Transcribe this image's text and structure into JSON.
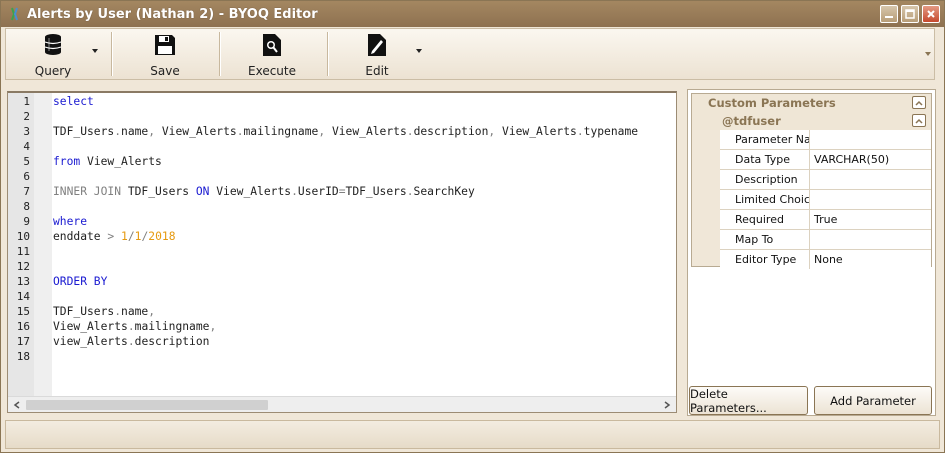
{
  "window": {
    "title": "Alerts by User (Nathan 2) - BYOQ Editor",
    "controls": [
      "minimize-icon",
      "maximize-icon",
      "close-icon"
    ]
  },
  "toolbar": {
    "query_label": "Query",
    "save_label": "Save",
    "execute_label": "Execute",
    "edit_label": "Edit"
  },
  "editor": {
    "line_numbers": [
      "1",
      "2",
      "3",
      "4",
      "5",
      "6",
      "7",
      "8",
      "9",
      "10",
      "11",
      "12",
      "13",
      "14",
      "15",
      "16",
      "17",
      "18"
    ],
    "tokens": {
      "l1_select": "select",
      "l3_a": "TDF_Users",
      "l3_dot1": ".",
      "l3_b": "name",
      "l3_c1": ",",
      "l3_c": " View_Alerts",
      "l3_dot2": ".",
      "l3_d": "mailingname",
      "l3_c2": ",",
      "l3_e": " View_Alerts",
      "l3_dot3": ".",
      "l3_f": "description",
      "l3_c3": ",",
      "l3_g": " View_Alerts",
      "l3_dot4": ".",
      "l3_h": "typename",
      "l5_from": "from",
      "l5_tbl": " View_Alerts",
      "l7_inner": "INNER JOIN",
      "l7_tbl": " TDF_Users ",
      "l7_on": "ON",
      "l7_a": " View_Alerts",
      "l7_dot1": ".",
      "l7_b": "UserID",
      "l7_eq": "=",
      "l7_c": "TDF_Users",
      "l7_dot2": ".",
      "l7_d": "SearchKey",
      "l9_where": "where",
      "l10_a": "enddate ",
      "l10_gt": ">",
      "l10_sp": " ",
      "l10_n1": "1",
      "l10_s1": "/",
      "l10_n2": "1",
      "l10_s2": "/",
      "l10_n3": "2018",
      "l13_order": "ORDER BY",
      "l15_a": "TDF_Users",
      "l15_dot": ".",
      "l15_b": "name",
      "l15_c": ",",
      "l16_a": "View_Alerts",
      "l16_dot": ".",
      "l16_b": "mailingname",
      "l16_c": ",",
      "l17_a": "view_Alerts",
      "l17_dot": ".",
      "l17_b": "description"
    },
    "scroll_left_icon": "chevron-left-icon",
    "scroll_right_icon": "chevron-right-icon"
  },
  "parameters": {
    "category": "Custom Parameters",
    "param_name": "@tdfuser",
    "rows": [
      {
        "name": "Parameter Na...",
        "value": ""
      },
      {
        "name": "Data Type",
        "value": "VARCHAR(50)"
      },
      {
        "name": "Description",
        "value": ""
      },
      {
        "name": "Limited Choic...",
        "value": ""
      },
      {
        "name": "Required",
        "value": "True"
      },
      {
        "name": "Map To",
        "value": ""
      },
      {
        "name": "Editor Type",
        "value": "None"
      }
    ],
    "delete_label": "Delete Parameters...",
    "add_label": "Add Parameter"
  },
  "colors": {
    "titlebar": "#9a7d58",
    "keyword": "#1b1bd1",
    "operator": "#808080",
    "number": "#e69a10",
    "category_text": "#8a7554"
  }
}
